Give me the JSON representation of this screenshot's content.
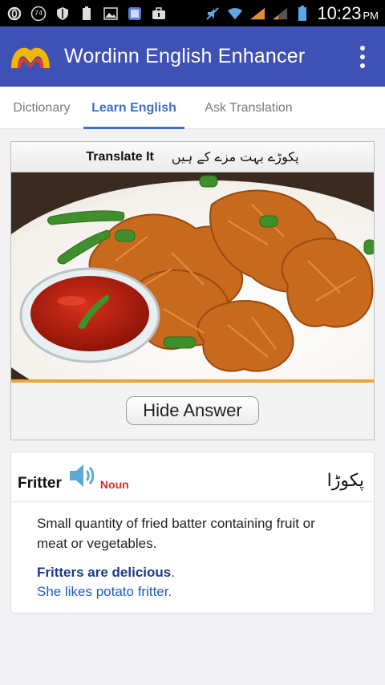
{
  "status_bar": {
    "time": "10:23",
    "ampm": "PM",
    "icons": [
      "opera-icon",
      "badge-74-icon",
      "shield-icon",
      "battery-small-icon",
      "image-icon",
      "photo-icon",
      "bag-icon",
      "mute-icon",
      "wifi-icon",
      "signal-icon",
      "signal-icon",
      "battery-icon"
    ],
    "badge_74": "74"
  },
  "app_bar": {
    "title": "Wordinn English Enhancer",
    "logo": "wordinn-logo",
    "menu_icon": "more-vert-icon",
    "color": "#3f51b5"
  },
  "tabs": [
    {
      "label": "Dictionary",
      "active": false
    },
    {
      "label": "Learn English",
      "active": true
    },
    {
      "label": "Ask Translation",
      "active": false
    }
  ],
  "quiz": {
    "header_label": "Translate It",
    "header_urdu": "پکوڑے بہت مزے کے ہیں",
    "image_alt": "Plate of pakoras (fritters) with ketchup and green chillies",
    "button_label": "Hide Answer"
  },
  "definition": {
    "word": "Fritter",
    "part_of_speech": "Noun",
    "urdu": "پکوڑا",
    "speaker_icon": "speaker-icon",
    "definition_text": "Small quantity of fried batter containing fruit or meat or vegetables.",
    "example_1_bold": "Fritters are delicious",
    "example_1_end": ".",
    "example_2": "She likes potato fritter."
  },
  "colors": {
    "accent_tab": "#3f6fc6",
    "pos_red": "#d32f2f",
    "example_blue": "#1f5fbf",
    "example_dark_blue": "#1a3a8a"
  }
}
